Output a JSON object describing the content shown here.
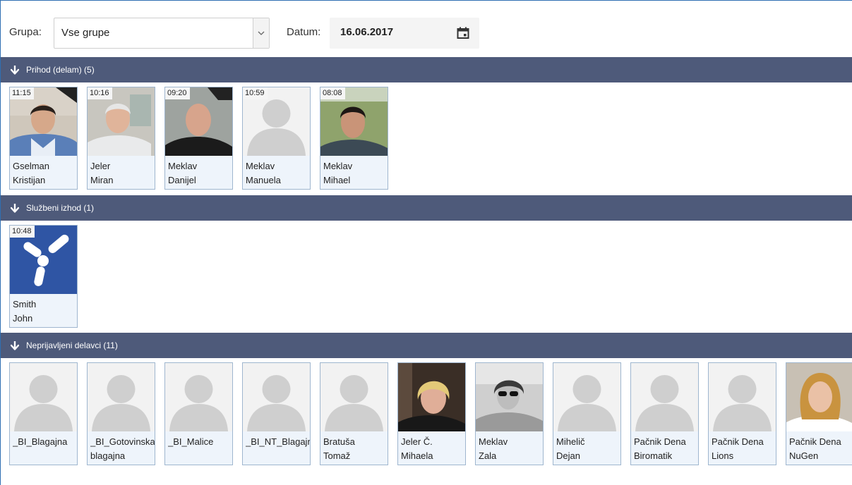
{
  "filter": {
    "group_label": "Grupa:",
    "group_value": "Vse grupe",
    "date_label": "Datum:",
    "date_value": "16.06.2017"
  },
  "sections": [
    {
      "title": "Prihod (delam) (5)",
      "cards": [
        {
          "time": "11:15",
          "last": "Gselman",
          "first": "Kristijan",
          "photo": "man-dark-hair"
        },
        {
          "time": "10:16",
          "last": "Jeler",
          "first": "Miran",
          "photo": "man-grey-hair"
        },
        {
          "time": "09:20",
          "last": "Meklav",
          "first": "Danijel",
          "photo": "man-bald"
        },
        {
          "time": "10:59",
          "last": "Meklav",
          "first": "Manuela",
          "photo": "placeholder"
        },
        {
          "time": "08:08",
          "last": "Meklav",
          "first": "Mihael",
          "photo": "man-young"
        }
      ]
    },
    {
      "title": "Službeni izhod (1)",
      "cards": [
        {
          "time": "10:48",
          "last": "Smith",
          "first": "John",
          "photo": "logo-y"
        }
      ]
    },
    {
      "title": "Neprijavljeni delavci (11)",
      "cards": [
        {
          "time": "",
          "last": "_BI_Blagajna",
          "first": "",
          "photo": "placeholder"
        },
        {
          "time": "",
          "last": "_BI_Gotovinska",
          "first": "blagajna",
          "photo": "placeholder"
        },
        {
          "time": "",
          "last": "_BI_Malice",
          "first": "",
          "photo": "placeholder"
        },
        {
          "time": "",
          "last": "_BI_NT_Blagajna",
          "first": "",
          "photo": "placeholder"
        },
        {
          "time": "",
          "last": "Bratuša",
          "first": "Tomaž",
          "photo": "placeholder"
        },
        {
          "time": "",
          "last": "Jeler Č.",
          "first": "Mihaela",
          "photo": "woman-blonde-short"
        },
        {
          "time": "",
          "last": "Meklav",
          "first": "Zala",
          "photo": "woman-sunglasses"
        },
        {
          "time": "",
          "last": "Mihelič",
          "first": "Dejan",
          "photo": "placeholder"
        },
        {
          "time": "",
          "last": "Pačnik Dena",
          "first": "Biromatik",
          "photo": "placeholder"
        },
        {
          "time": "",
          "last": "Pačnik Dena",
          "first": "Lions",
          "photo": "placeholder"
        },
        {
          "time": "",
          "last": "Pačnik Dena",
          "first": "NuGen",
          "photo": "woman-blonde-long"
        }
      ]
    }
  ],
  "icons": {
    "dropdown": "chevron-down-icon",
    "calendar": "calendar-icon",
    "section_toggle": "arrow-down-icon"
  },
  "colors": {
    "section_header": "#4e5a7a",
    "card_border": "#9fb6cf",
    "card_bg": "#eef4fb",
    "logo_bg": "#2f55a4"
  }
}
